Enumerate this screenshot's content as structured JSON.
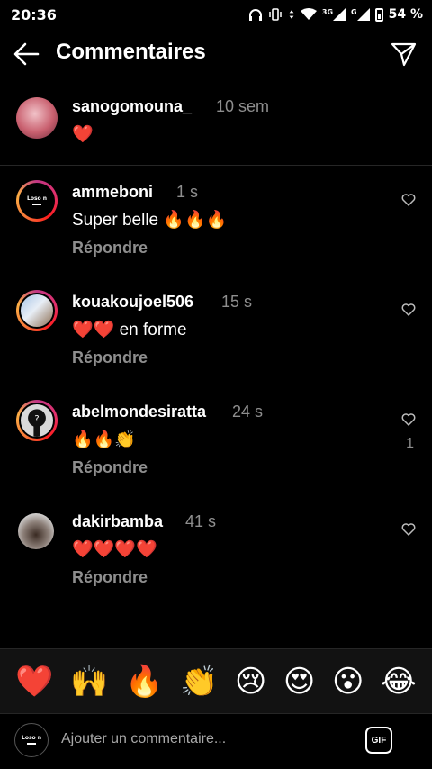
{
  "status_bar": {
    "time": "20:36",
    "network": "3G",
    "signal_label": "G",
    "battery": "54 %"
  },
  "header": {
    "title": "Commentaires"
  },
  "caption": {
    "username": "sanogomouna_",
    "time": "10 sem",
    "text": "❤️"
  },
  "comments": [
    {
      "username": "ammeboni",
      "time": "1 s",
      "text": "Super belle 🔥🔥🔥",
      "reply": "Répondre",
      "likes": ""
    },
    {
      "username": "kouakoujoel506",
      "time": "15 s",
      "text": "❤️❤️ en forme",
      "reply": "Répondre",
      "likes": ""
    },
    {
      "username": "abelmondesiratta",
      "time": "24 s",
      "text": "🔥🔥👏",
      "reply": "Répondre",
      "likes": "1"
    },
    {
      "username": "dakirbamba",
      "time": "41 s",
      "text": "❤️❤️❤️❤️",
      "reply": "Répondre",
      "likes": ""
    }
  ],
  "emoji_bar": [
    "❤️",
    "🙌",
    "🔥",
    "👏",
    "😢",
    "😍",
    "😮",
    "😂"
  ],
  "composer": {
    "placeholder": "Ajouter un commentaire...",
    "gif_label": "GIF"
  },
  "avatar_logo_text": "Loso n",
  "colors": {
    "background": "#000000",
    "secondary_text": "#8e8e8e",
    "divider": "#262626",
    "emoji_bar_bg": "#121212"
  }
}
